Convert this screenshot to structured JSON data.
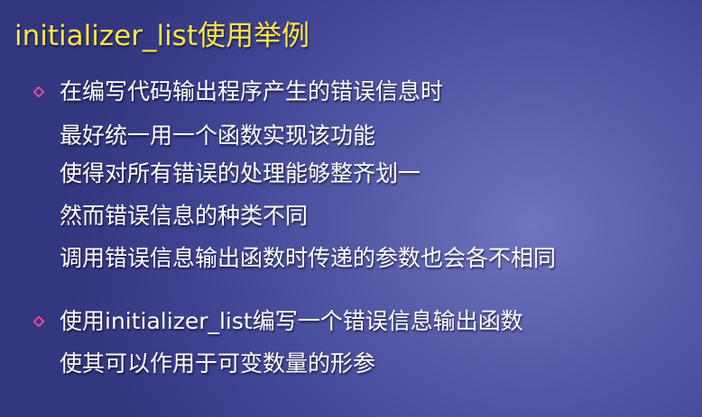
{
  "slide": {
    "title": "initializer_list使用举例",
    "bullets": [
      {
        "lines": [
          "在编写代码输出程序产生的错误信息时",
          "最好统一用一个函数实现该功能",
          "使得对所有错误的处理能够整齐划一",
          "然而错误信息的种类不同",
          "调用错误信息输出函数时传递的参数也会各不相同"
        ]
      },
      {
        "lines": [
          "使用initializer_list编写一个错误信息输出函数",
          "使其可以作用于可变数量的形参"
        ]
      }
    ]
  },
  "colors": {
    "title": "#ffe44a",
    "text": "#ffffff",
    "bullet_marker": "#e0489a",
    "background": "#4a4f9e"
  }
}
